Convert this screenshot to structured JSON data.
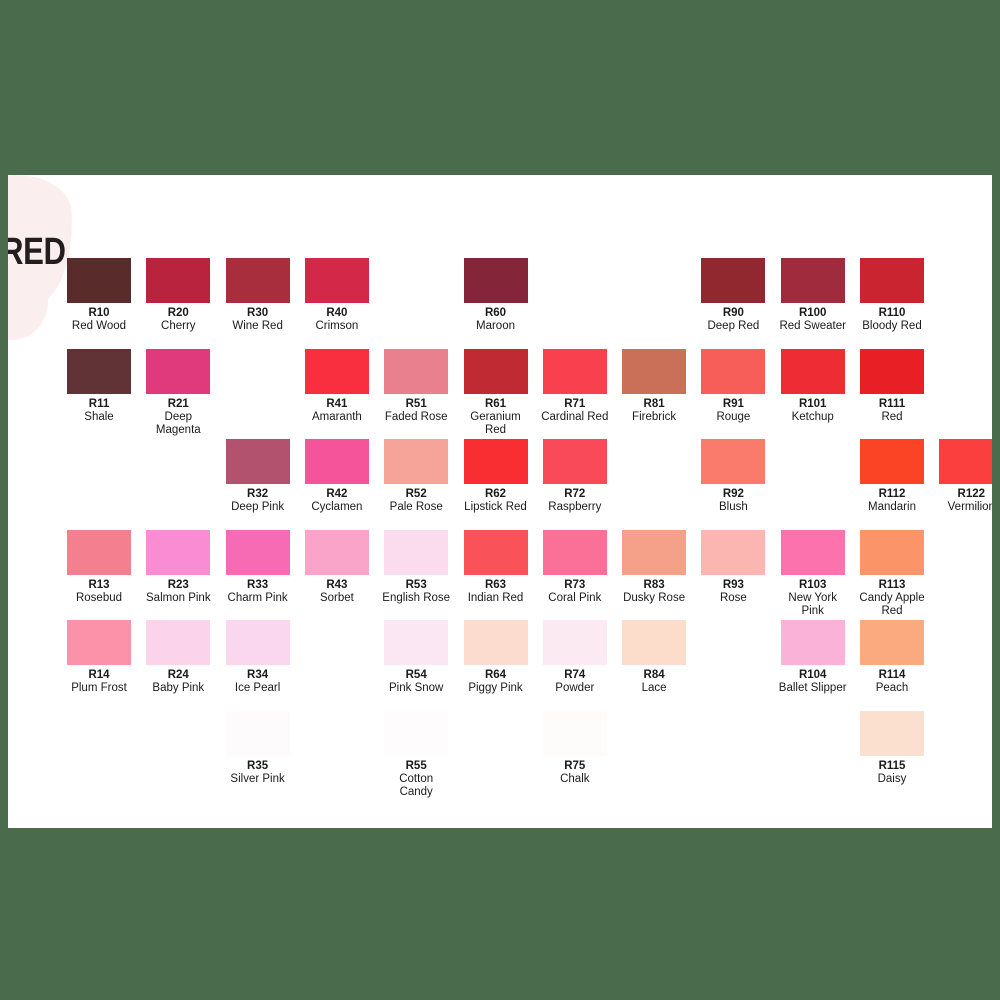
{
  "page": {
    "background_color": "#4a6b4c",
    "card_color": "#ffffff",
    "title": "RED",
    "decor_color": "#fbeeef"
  },
  "chart_data": {
    "type": "table",
    "title": "RED",
    "subtitle": "",
    "xlabel": "",
    "ylabel": "",
    "description": "Marker colour swatch chart for the RED family, arranged in a 12-column x 6-row grid. Each cell shows a colour rectangle with its code and name.",
    "columns": 12,
    "rows": 6,
    "swatches": [
      {
        "row": 1,
        "col": 1,
        "code": "R10",
        "name": "Red Wood",
        "hex": "#5a2b2b"
      },
      {
        "row": 1,
        "col": 2,
        "code": "R20",
        "name": "Cherry",
        "hex": "#b9233d"
      },
      {
        "row": 1,
        "col": 3,
        "code": "R30",
        "name": "Wine Red",
        "hex": "#a82e3e"
      },
      {
        "row": 1,
        "col": 4,
        "code": "R40",
        "name": "Crimson",
        "hex": "#d32847"
      },
      {
        "row": 1,
        "col": 6,
        "code": "R60",
        "name": "Maroon",
        "hex": "#85253a"
      },
      {
        "row": 1,
        "col": 9,
        "code": "R90",
        "name": "Deep Red",
        "hex": "#92282f"
      },
      {
        "row": 1,
        "col": 10,
        "code": "R100",
        "name": "Red Sweater",
        "hex": "#9f2b3c"
      },
      {
        "row": 1,
        "col": 11,
        "code": "R110",
        "name": "Bloody Red",
        "hex": "#c92430"
      },
      {
        "row": 2,
        "col": 1,
        "code": "R11",
        "name": "Shale",
        "hex": "#623336"
      },
      {
        "row": 2,
        "col": 2,
        "code": "R21",
        "name": "Deep Magenta",
        "hex": "#e03a7c"
      },
      {
        "row": 2,
        "col": 4,
        "code": "R41",
        "name": "Amaranth",
        "hex": "#f92e3e"
      },
      {
        "row": 2,
        "col": 5,
        "code": "R51",
        "name": "Faded Rose",
        "hex": "#e8818d"
      },
      {
        "row": 2,
        "col": 6,
        "code": "R61",
        "name": "Geranium Red",
        "hex": "#c02b33"
      },
      {
        "row": 2,
        "col": 7,
        "code": "R71",
        "name": "Cardinal Red",
        "hex": "#f9404f"
      },
      {
        "row": 2,
        "col": 8,
        "code": "R81",
        "name": "Firebrick",
        "hex": "#ca6f58"
      },
      {
        "row": 2,
        "col": 9,
        "code": "R91",
        "name": "Rouge",
        "hex": "#f85e59"
      },
      {
        "row": 2,
        "col": 10,
        "code": "R101",
        "name": "Ketchup",
        "hex": "#ee2c33"
      },
      {
        "row": 2,
        "col": 11,
        "code": "R111",
        "name": "Red",
        "hex": "#e81f25"
      },
      {
        "row": 3,
        "col": 3,
        "code": "R32",
        "name": "Deep Pink",
        "hex": "#b3526e"
      },
      {
        "row": 3,
        "col": 4,
        "code": "R42",
        "name": "Cyclamen",
        "hex": "#f6549a"
      },
      {
        "row": 3,
        "col": 5,
        "code": "R52",
        "name": "Pale Rose",
        "hex": "#f6a399"
      },
      {
        "row": 3,
        "col": 6,
        "code": "R62",
        "name": "Lipstick Red",
        "hex": "#f82e33"
      },
      {
        "row": 3,
        "col": 7,
        "code": "R72",
        "name": "Raspberry",
        "hex": "#f84a58"
      },
      {
        "row": 3,
        "col": 9,
        "code": "R92",
        "name": "Blush",
        "hex": "#fa7a6b"
      },
      {
        "row": 3,
        "col": 11,
        "code": "R112",
        "name": "Mandarin",
        "hex": "#fb4326"
      },
      {
        "row": 3,
        "col": 12,
        "code": "R122",
        "name": "Vermilion",
        "hex": "#fb3f3f"
      },
      {
        "row": 4,
        "col": 1,
        "code": "R13",
        "name": "Rosebud",
        "hex": "#f4808f"
      },
      {
        "row": 4,
        "col": 2,
        "code": "R23",
        "name": "Salmon Pink",
        "hex": "#f98cd2"
      },
      {
        "row": 4,
        "col": 3,
        "code": "R33",
        "name": "Charm Pink",
        "hex": "#f76ab4"
      },
      {
        "row": 4,
        "col": 4,
        "code": "R43",
        "name": "Sorbet",
        "hex": "#fba4ca"
      },
      {
        "row": 4,
        "col": 5,
        "code": "R53",
        "name": "English Rose",
        "hex": "#fbdcee"
      },
      {
        "row": 4,
        "col": 6,
        "code": "R63",
        "name": "Indian Red",
        "hex": "#f95359"
      },
      {
        "row": 4,
        "col": 7,
        "code": "R73",
        "name": "Coral Pink",
        "hex": "#fb7096"
      },
      {
        "row": 4,
        "col": 8,
        "code": "R83",
        "name": "Dusky Rose",
        "hex": "#f5a189"
      },
      {
        "row": 4,
        "col": 9,
        "code": "R93",
        "name": "Rose",
        "hex": "#fbb6b2"
      },
      {
        "row": 4,
        "col": 10,
        "code": "R103",
        "name": "New York Pink",
        "hex": "#fb72ac"
      },
      {
        "row": 4,
        "col": 11,
        "code": "R113",
        "name": "Candy Apple Red",
        "hex": "#fb9468"
      },
      {
        "row": 5,
        "col": 1,
        "code": "R14",
        "name": "Plum Frost",
        "hex": "#fb92aa"
      },
      {
        "row": 5,
        "col": 2,
        "code": "R24",
        "name": "Baby Pink",
        "hex": "#fbd4ec"
      },
      {
        "row": 5,
        "col": 3,
        "code": "R34",
        "name": "Ice Pearl",
        "hex": "#fbd6ef"
      },
      {
        "row": 5,
        "col": 5,
        "code": "R54",
        "name": "Pink Snow",
        "hex": "#fbe6f4"
      },
      {
        "row": 5,
        "col": 6,
        "code": "R64",
        "name": "Piggy Pink",
        "hex": "#fcdccf"
      },
      {
        "row": 5,
        "col": 7,
        "code": "R74",
        "name": "Powder",
        "hex": "#fbeaf2"
      },
      {
        "row": 5,
        "col": 8,
        "code": "R84",
        "name": "Lace",
        "hex": "#fcddcc"
      },
      {
        "row": 5,
        "col": 10,
        "code": "R104",
        "name": "Ballet Slipper",
        "hex": "#fbb2d8"
      },
      {
        "row": 5,
        "col": 11,
        "code": "R114",
        "name": "Peach",
        "hex": "#fba97e"
      },
      {
        "row": 6,
        "col": 3,
        "code": "R35",
        "name": "Silver Pink",
        "hex": "#fdfbfb"
      },
      {
        "row": 6,
        "col": 5,
        "code": "R55",
        "name": "Cotton Candy",
        "hex": "#fefcfd"
      },
      {
        "row": 6,
        "col": 7,
        "code": "R75",
        "name": "Chalk",
        "hex": "#fefcfa"
      },
      {
        "row": 6,
        "col": 11,
        "code": "R115",
        "name": "Daisy",
        "hex": "#fce0cf"
      }
    ]
  }
}
